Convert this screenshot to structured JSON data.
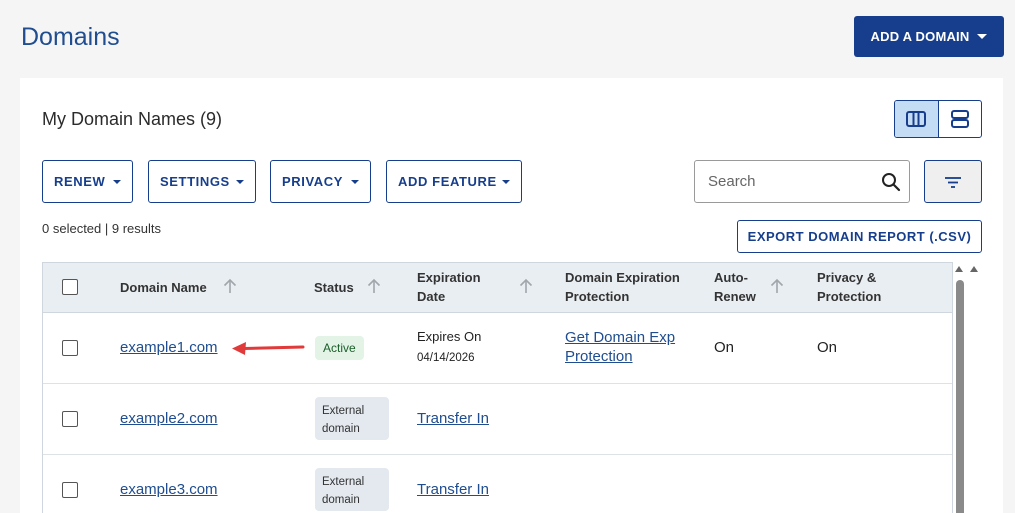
{
  "page": {
    "title": "Domains",
    "add_domain_label": "ADD A DOMAIN"
  },
  "card": {
    "title": "My Domain Names (9)",
    "toolbar": {
      "renew_label": "RENEW",
      "settings_label": "SETTINGS",
      "privacy_label": "PRIVACY",
      "add_feature_label": "ADD FEATURE",
      "search_placeholder": "Search"
    },
    "results_text": "0 selected | 9 results",
    "export_label": "EXPORT DOMAIN REPORT (.CSV)"
  },
  "table": {
    "headers": {
      "domain_name": "Domain Name",
      "status": "Status",
      "expiration_date_1": "Expiration",
      "expiration_date_2": "Date",
      "exp_protection_1": "Domain Expiration",
      "exp_protection_2": "Protection",
      "auto_renew_1": "Auto-",
      "auto_renew_2": "Renew",
      "privacy_1": "Privacy &",
      "privacy_2": "Protection"
    },
    "rows": [
      {
        "domain": "example1.com",
        "status": "Active",
        "expires_label": "Expires On",
        "expires_date": "04/14/2026",
        "protection_link_1": "Get Domain Exp",
        "protection_link_2": "Protection",
        "auto_renew": "On",
        "privacy": "On"
      },
      {
        "domain": "example2.com",
        "status_1": "External",
        "status_2": "domain",
        "transfer": "Transfer In"
      },
      {
        "domain": "example3.com",
        "status_1": "External",
        "status_2": "domain",
        "transfer": "Transfer In"
      }
    ]
  },
  "colors": {
    "brand": "#173e8c",
    "title": "#1f4d8f",
    "annotation_arrow": "#e03a3a"
  }
}
